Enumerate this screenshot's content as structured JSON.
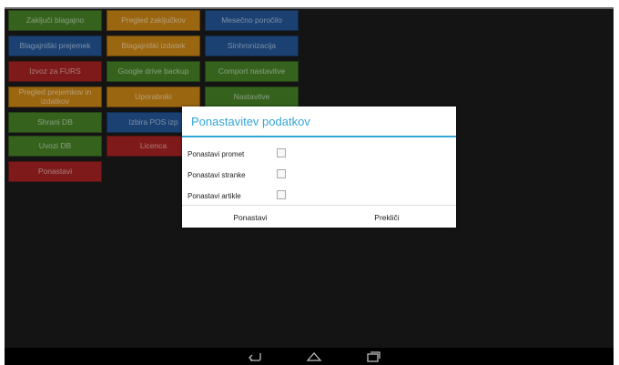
{
  "menu": {
    "tiles": [
      {
        "label": "Zaključi blagajno",
        "color": "#3f7a22"
      },
      {
        "label": "Pregled zaključkov",
        "color": "#c27d0f"
      },
      {
        "label": "Mesečno poročilo",
        "color": "#1d4e8e"
      },
      {
        "label": "Blagajniški prejemek",
        "color": "#1d4e8e"
      },
      {
        "label": "Blagajniški izdatek",
        "color": "#c27d0f"
      },
      {
        "label": "Sinhronizacija",
        "color": "#1d4e8e"
      },
      {
        "label": "Izvoz za FURS",
        "color": "#9c1e1c"
      },
      {
        "label": "Google drive backup",
        "color": "#3f7a22"
      },
      {
        "label": "Comport nastavitve",
        "color": "#3f7a22"
      },
      {
        "label": "Pregled prejemkov in izdatkov",
        "color": "#c27d0f"
      },
      {
        "label": "Uporabniki",
        "color": "#c27d0f"
      },
      {
        "label": "Nastavitve",
        "color": "#3f7a22"
      },
      {
        "label": "Shrani DB",
        "color": "#3f7a22"
      },
      {
        "label": "Izbira POS izp",
        "color": "#1d4e8e"
      },
      {
        "label": "Uvozi DB",
        "color": "#3f7a22"
      },
      {
        "label": "Licenca",
        "color": "#9c1e1c"
      },
      {
        "label": "Ponastavi",
        "color": "#9c1e1c"
      }
    ]
  },
  "dialog": {
    "title": "Ponastavitev podatkov",
    "accent_color": "#33a6d8",
    "options": [
      {
        "label": "Ponastavi promet",
        "checked": false
      },
      {
        "label": "Ponastavi stranke",
        "checked": false
      },
      {
        "label": "Ponastavi artikle",
        "checked": false
      }
    ],
    "confirm_label": "Ponastavi",
    "cancel_label": "Prekliči"
  },
  "navbar": {
    "icons": [
      "back-icon",
      "home-icon",
      "recent-apps-icon"
    ]
  }
}
